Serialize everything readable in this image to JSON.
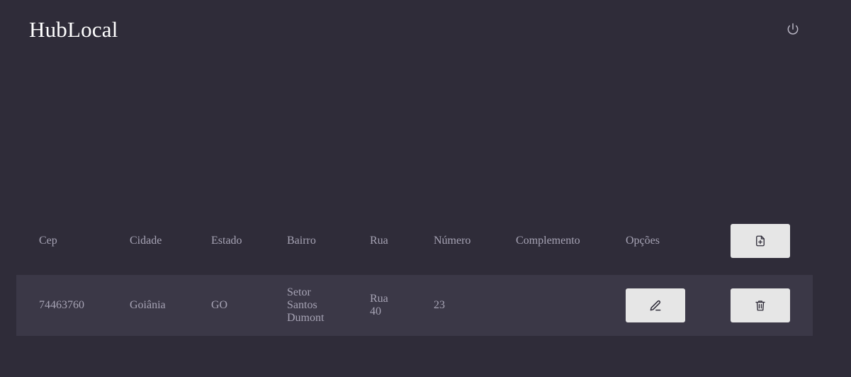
{
  "header": {
    "brand": "HubLocal",
    "logout_icon": "power-icon"
  },
  "table": {
    "columns": [
      "Cep",
      "Cidade",
      "Estado",
      "Bairro",
      "Rua",
      "Número",
      "Complemento",
      "Opções"
    ],
    "add_icon": "file-plus-icon",
    "rows": [
      {
        "cep": "74463760",
        "cidade": "Goiânia",
        "estado": "GO",
        "bairro": "Setor Santos Dumont",
        "rua": "Rua 40",
        "numero": "23",
        "complemento": "",
        "edit_icon": "pencil-icon",
        "delete_icon": "trash-icon"
      }
    ]
  },
  "colors": {
    "background": "#2f2c39",
    "row_background": "#3b3847",
    "text": "#a6a3b4",
    "brand_text": "#ffffff",
    "button_background": "#e6e6e6"
  }
}
